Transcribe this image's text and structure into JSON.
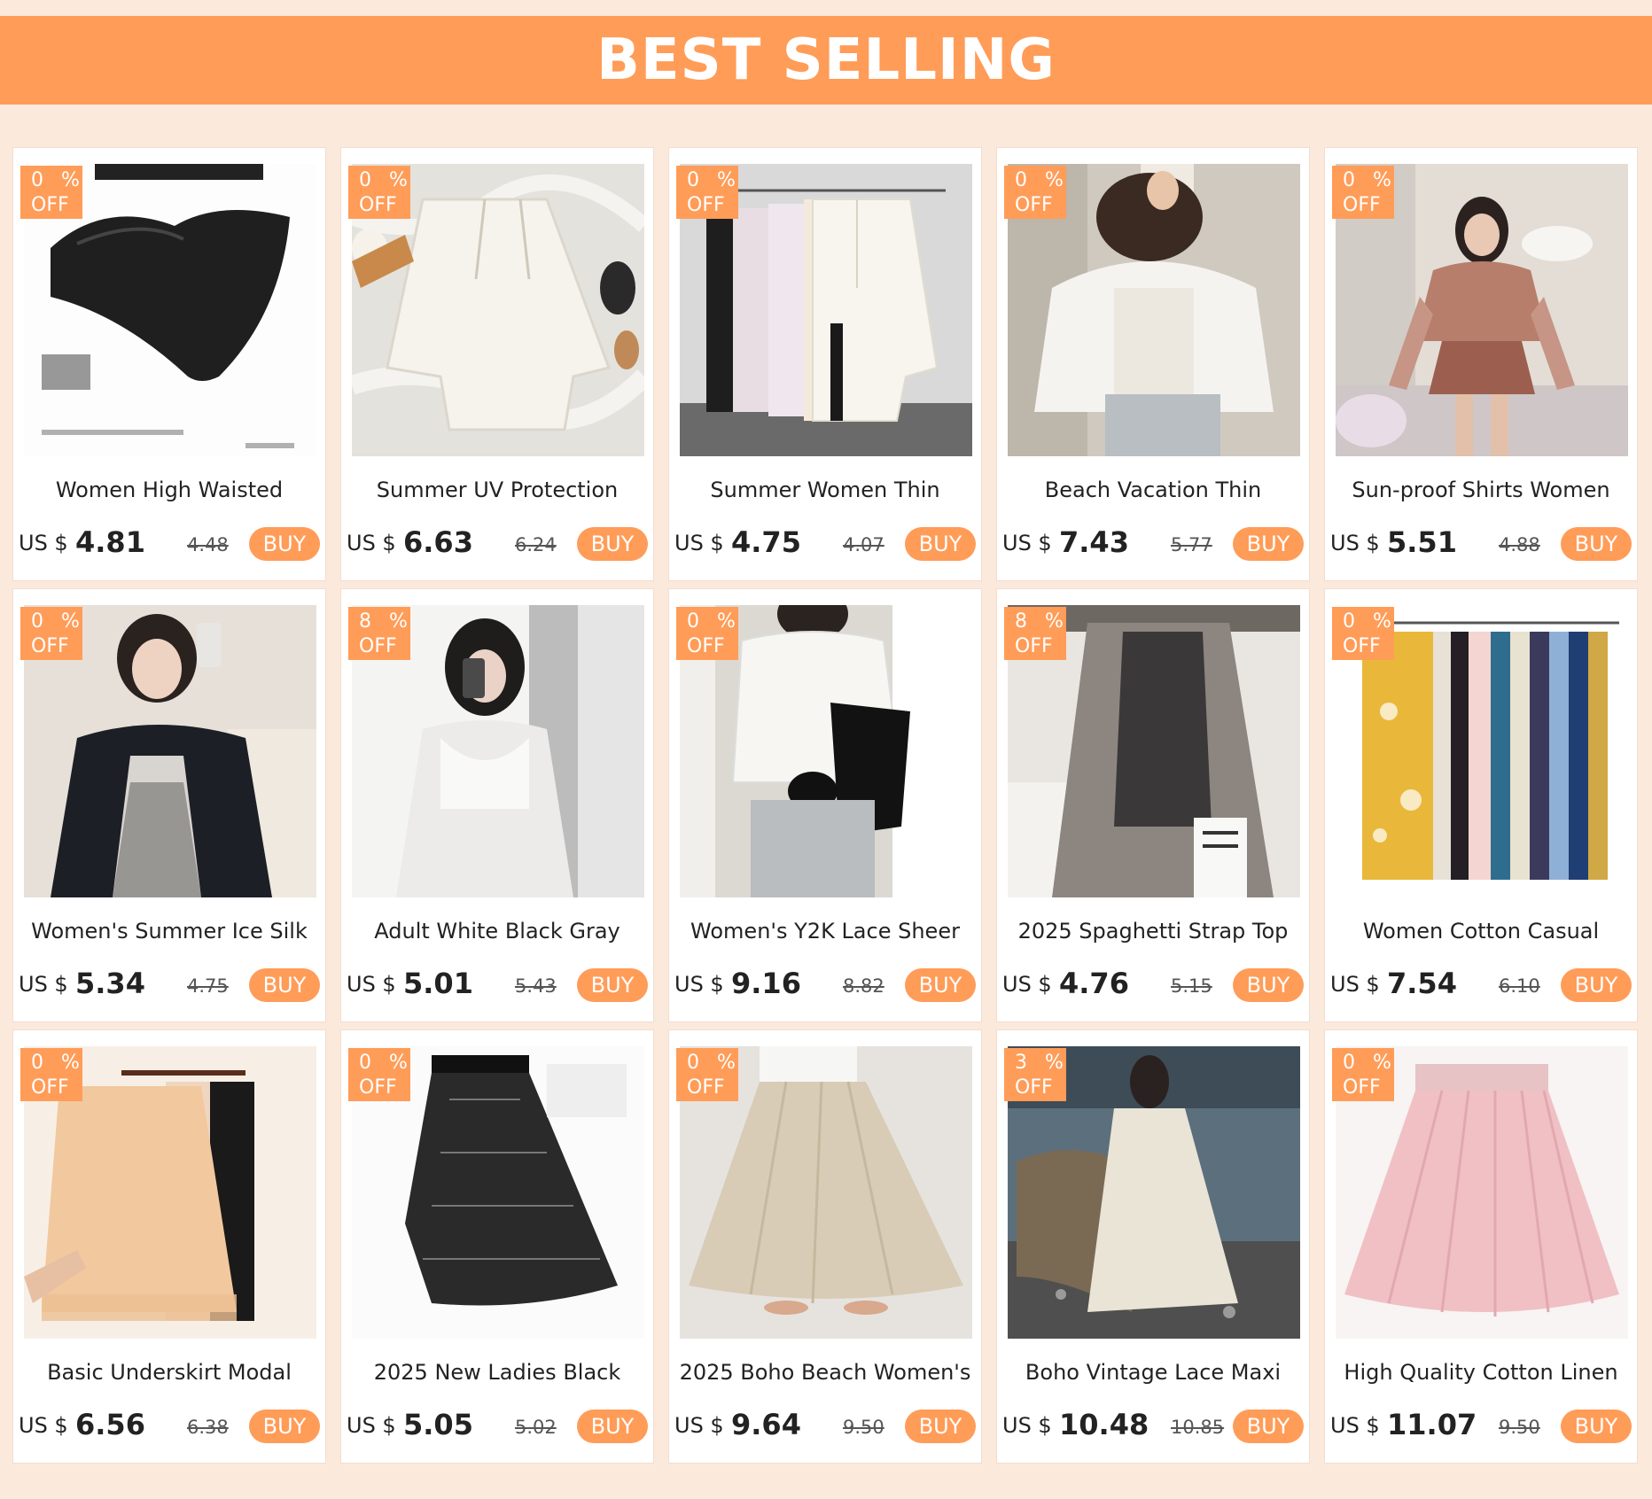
{
  "banner": {
    "title": "BEST SELLING"
  },
  "badge_colors": {
    "accent": "#ff9c58"
  },
  "products": [
    {
      "discount": "0",
      "percent": "%",
      "off": "OFF",
      "title": "Women High Waisted",
      "currency": "US $",
      "price": "4.81",
      "old_price": "4.48",
      "buy": "BUY"
    },
    {
      "discount": "0",
      "percent": "%",
      "off": "OFF",
      "title": "Summer UV Protection",
      "currency": "US $",
      "price": "6.63",
      "old_price": "6.24",
      "buy": "BUY"
    },
    {
      "discount": "0",
      "percent": "%",
      "off": "OFF",
      "title": "Summer Women Thin",
      "currency": "US $",
      "price": "4.75",
      "old_price": "4.07",
      "buy": "BUY"
    },
    {
      "discount": "0",
      "percent": "%",
      "off": "OFF",
      "title": "Beach Vacation Thin",
      "currency": "US $",
      "price": "7.43",
      "old_price": "5.77",
      "buy": "BUY"
    },
    {
      "discount": "0",
      "percent": "%",
      "off": "OFF",
      "title": "Sun-proof Shirts Women",
      "currency": "US $",
      "price": "5.51",
      "old_price": "4.88",
      "buy": "BUY"
    },
    {
      "discount": "0",
      "percent": "%",
      "off": "OFF",
      "title": "Women's Summer Ice Silk",
      "currency": "US $",
      "price": "5.34",
      "old_price": "4.75",
      "buy": "BUY"
    },
    {
      "discount": "8",
      "percent": "%",
      "off": "OFF",
      "title": "Adult White Black Gray",
      "currency": "US $",
      "price": "5.01",
      "old_price": "5.43",
      "buy": "BUY"
    },
    {
      "discount": "0",
      "percent": "%",
      "off": "OFF",
      "title": "Women's Y2K Lace Sheer",
      "currency": "US $",
      "price": "9.16",
      "old_price": "8.82",
      "buy": "BUY"
    },
    {
      "discount": "8",
      "percent": "%",
      "off": "OFF",
      "title": "2025 Spaghetti Strap Top",
      "currency": "US $",
      "price": "4.76",
      "old_price": "5.15",
      "buy": "BUY"
    },
    {
      "discount": "0",
      "percent": "%",
      "off": "OFF",
      "title": "Women Cotton Casual",
      "currency": "US $",
      "price": "7.54",
      "old_price": "6.10",
      "buy": "BUY"
    },
    {
      "discount": "0",
      "percent": "%",
      "off": "OFF",
      "title": "Basic Underskirt Modal",
      "currency": "US $",
      "price": "6.56",
      "old_price": "6.38",
      "buy": "BUY"
    },
    {
      "discount": "0",
      "percent": "%",
      "off": "OFF",
      "title": "2025 New Ladies Black",
      "currency": "US $",
      "price": "5.05",
      "old_price": "5.02",
      "buy": "BUY"
    },
    {
      "discount": "0",
      "percent": "%",
      "off": "OFF",
      "title": "2025 Boho Beach Women's",
      "currency": "US $",
      "price": "9.64",
      "old_price": "9.50",
      "buy": "BUY"
    },
    {
      "discount": "3",
      "percent": "%",
      "off": "OFF",
      "title": "Boho Vintage Lace Maxi",
      "currency": "US $",
      "price": "10.48",
      "old_price": "10.85",
      "buy": "BUY"
    },
    {
      "discount": "0",
      "percent": "%",
      "off": "OFF",
      "title": "High Quality Cotton Linen",
      "currency": "US $",
      "price": "11.07",
      "old_price": "9.50",
      "buy": "BUY"
    }
  ]
}
